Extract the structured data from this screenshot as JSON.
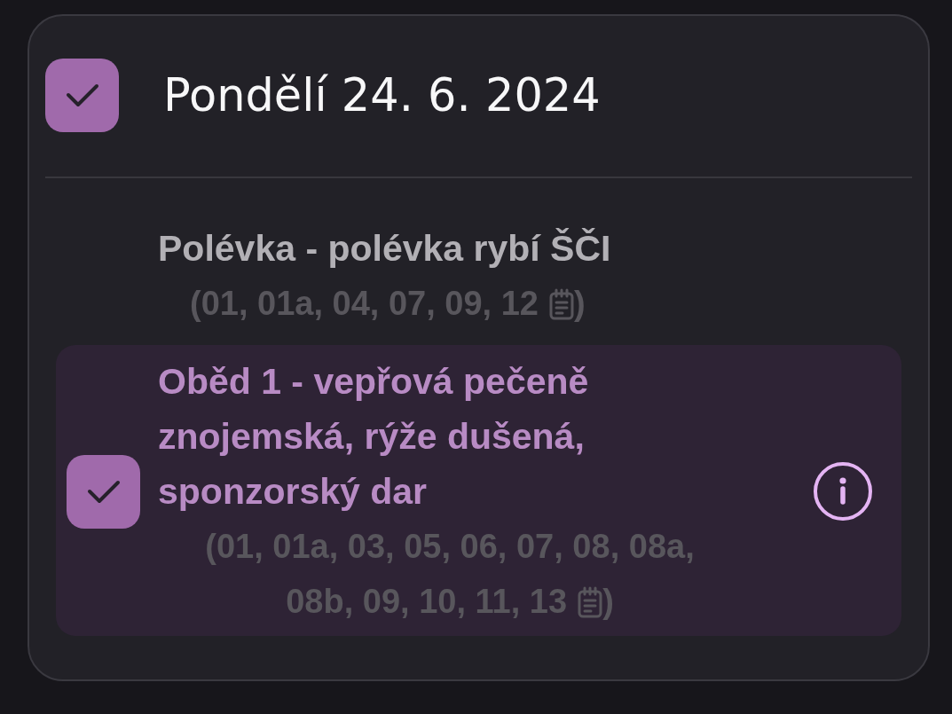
{
  "day": {
    "title": "Pondělí 24. 6. 2024",
    "checked": true
  },
  "items": [
    {
      "kind": "soup",
      "selected": false,
      "name": "Polévka - polévka rybí ŠČI",
      "allergens": "(01, 01a, 04, 07, 09, 12",
      "allergens_end": ")"
    },
    {
      "kind": "meal",
      "selected": true,
      "name": "Oběd 1 - vepřová pečeně znojemská, rýže dušená, sponzorský dar",
      "allergens": "(01, 01a, 03, 05, 06, 07, 08, 08a, 08b, 09, 10, 11, 13",
      "allergens_end": ")"
    }
  ]
}
